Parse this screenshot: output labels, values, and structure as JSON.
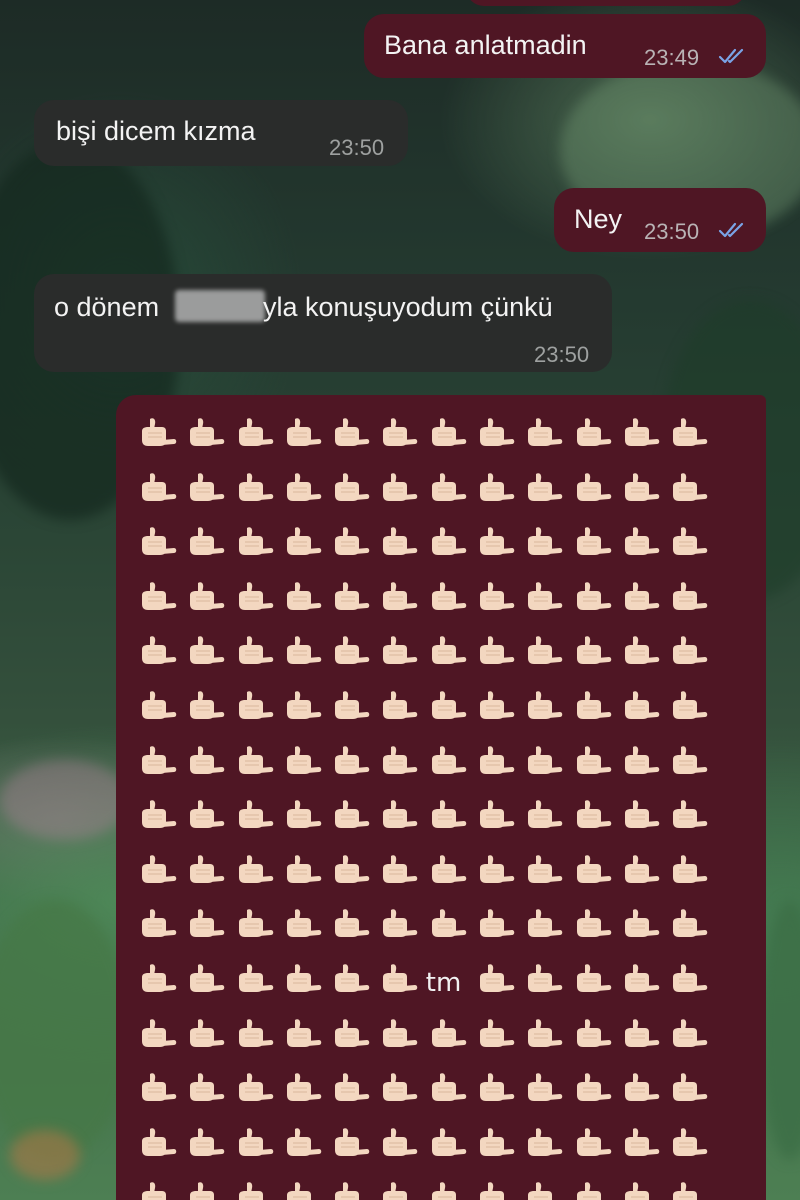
{
  "messages": [
    {
      "id": "m0",
      "direction": "out",
      "text": "",
      "time": "",
      "read": false
    },
    {
      "id": "m1",
      "direction": "out",
      "text": "Bana anlatmadin",
      "time": "23:49",
      "read": true
    },
    {
      "id": "m2",
      "direction": "in",
      "text": "bişi dicem kızma",
      "time": "23:50"
    },
    {
      "id": "m3",
      "direction": "out",
      "text": "Ney",
      "time": "23:50",
      "read": true
    },
    {
      "id": "m4",
      "direction": "in",
      "text_before": "o dönem",
      "text_after": "yla konuşuyodum çünkü",
      "redacted": true,
      "time": "23:50"
    }
  ],
  "emoji_message": {
    "direction": "out",
    "emoji": "call-me-hand",
    "inline_text": "tm",
    "visible_rows": 15,
    "columns": 12,
    "tm_row": 10,
    "tm_col": 6
  },
  "colors": {
    "outgoing_bubble": "#4f1624",
    "incoming_bubble": "#2a2c2b",
    "read_ticks": "#7aa3e6",
    "emoji_skin": "#f3d7c0"
  }
}
